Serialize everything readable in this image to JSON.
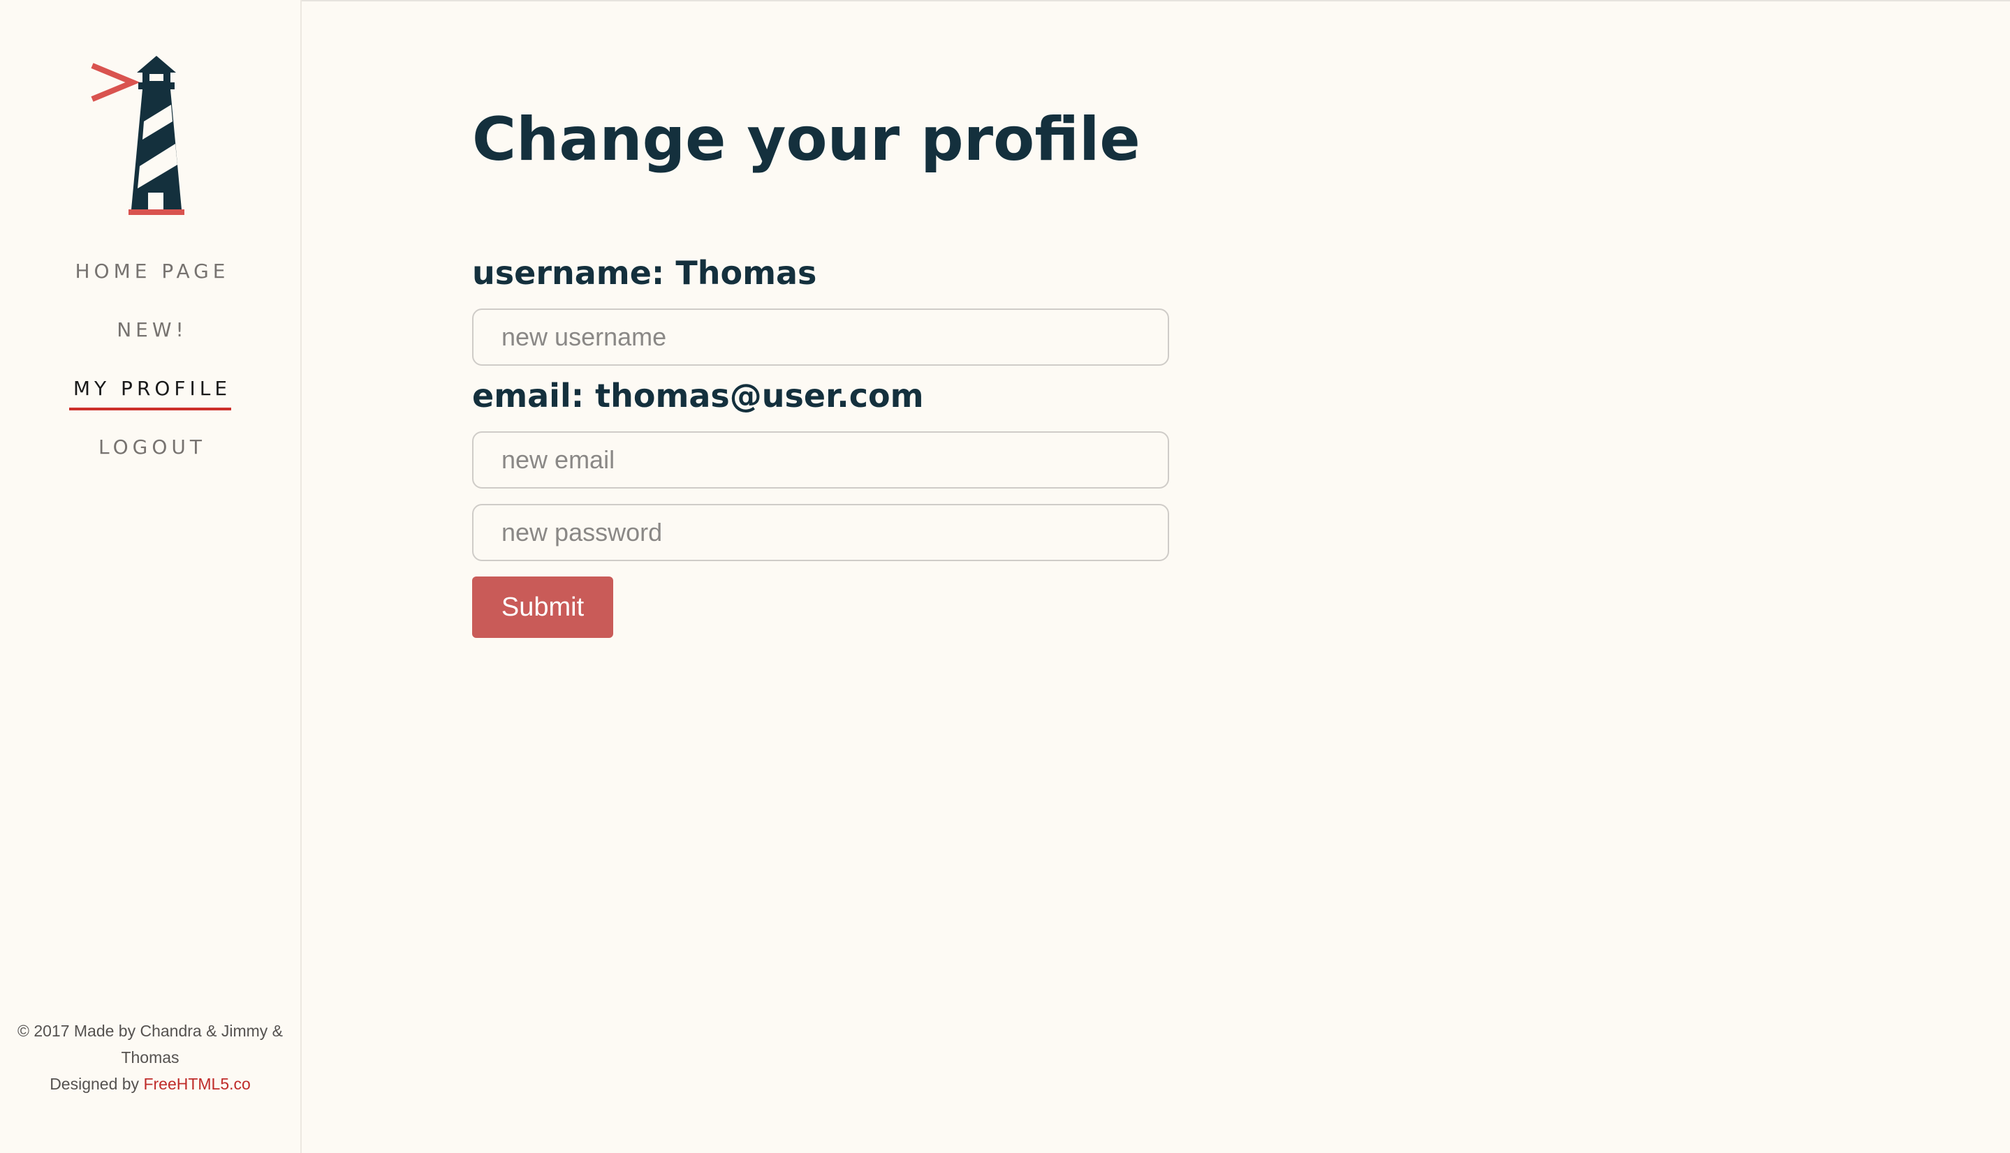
{
  "sidebar": {
    "logo": {
      "icon": "lighthouse-logo-icon",
      "colors": {
        "tower": "#14303d",
        "accent": "#d9534f"
      }
    },
    "nav": [
      {
        "label": "HOME PAGE",
        "active": false
      },
      {
        "label": "NEW!",
        "active": false
      },
      {
        "label": "MY PROFILE",
        "active": true
      },
      {
        "label": "LOGOUT",
        "active": false
      }
    ],
    "footer": {
      "line1": "© 2017 Made by Chandra & Jimmy & Thomas",
      "line2_prefix": "Designed by ",
      "line2_link": "FreeHTML5.co"
    }
  },
  "main": {
    "title": "Change your profile",
    "username_label": "username: Thomas",
    "username_placeholder": "new username",
    "email_label": "email: thomas@user.com",
    "email_placeholder": "new email",
    "password_placeholder": "new password",
    "submit_label": "Submit"
  },
  "colors": {
    "background": "#fdfaf4",
    "heading": "#14303d",
    "button": "#c95b58",
    "active_underline": "#cc2f2a",
    "link": "#bf2c2a"
  }
}
